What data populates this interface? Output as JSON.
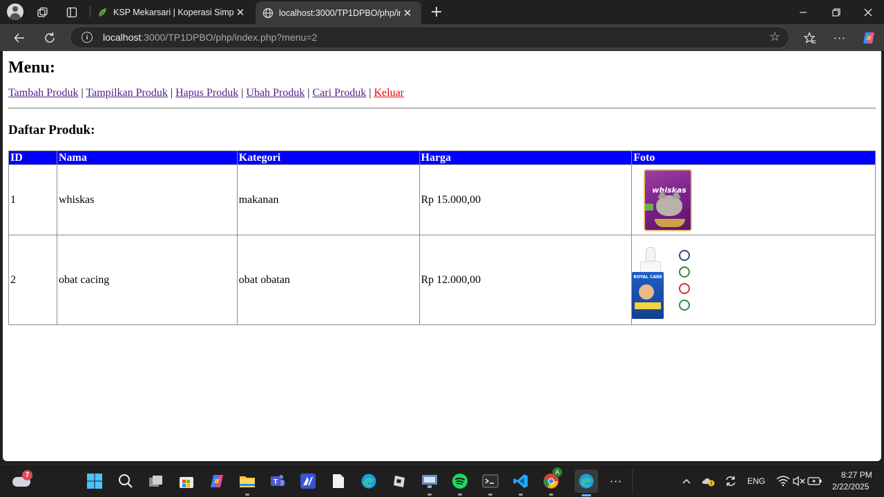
{
  "browser": {
    "tabs": [
      {
        "title": "KSP Mekarsari | Koperasi Simpan P",
        "active": false
      },
      {
        "title": "localhost:3000/TP1DPBO/php/ind",
        "active": true
      }
    ],
    "url_host": "localhost",
    "url_rest": ":3000/TP1DPBO/php/index.php?menu=2"
  },
  "page": {
    "menu_heading": "Menu:",
    "menu_links": [
      {
        "label": "Tambah Produk"
      },
      {
        "label": "Tampilkan Produk"
      },
      {
        "label": "Hapus Produk"
      },
      {
        "label": "Ubah Produk"
      },
      {
        "label": "Cari Produk"
      },
      {
        "label": "Keluar"
      }
    ],
    "separator": "|",
    "list_heading": "Daftar Produk:",
    "table": {
      "headers": [
        "ID",
        "Nama",
        "Kategori",
        "Harga",
        "Foto"
      ],
      "rows": [
        {
          "id": "1",
          "nama": "whiskas",
          "kategori": "makanan",
          "harga": "Rp 15.000,00",
          "foto": "whiskas-image"
        },
        {
          "id": "2",
          "nama": "obat cacing",
          "kategori": "obat obatan",
          "harga": "Rp 12.000,00",
          "foto": "obat-cacing-image"
        }
      ]
    }
  },
  "product_images": {
    "whiskas": {
      "brand_text": "whiskas"
    },
    "obat": {
      "box_text": "ROYAL CARE"
    }
  },
  "taskbar": {
    "weather_badge": "7",
    "language": "ENG",
    "time": "8:27 PM",
    "date": "2/22/2025",
    "copilot_badge": "A"
  },
  "colors": {
    "table_header_bg": "#0000ff",
    "visited_link": "#551a8b",
    "logout_link": "#ee0000"
  }
}
